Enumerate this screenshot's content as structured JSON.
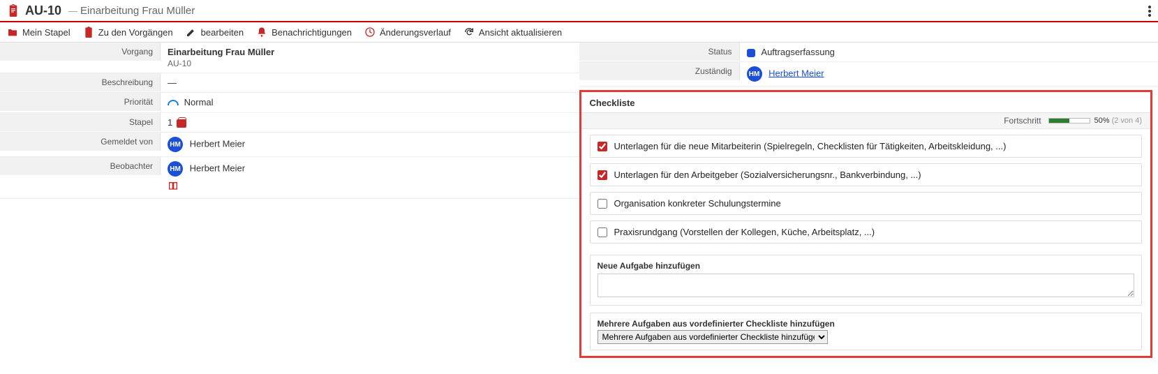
{
  "header": {
    "id": "AU-10",
    "separator": "—",
    "subtitle": "Einarbeitung Frau Müller"
  },
  "toolbar": {
    "mein_stapel": "Mein Stapel",
    "zu_vorgaengen": "Zu den Vorgängen",
    "bearbeiten": "bearbeiten",
    "benachrichtigungen": "Benachrichtigungen",
    "aenderungsverlauf": "Änderungsverlauf",
    "ansicht_aktualisieren": "Ansicht aktualisieren"
  },
  "fields_left": {
    "vorgang": {
      "label": "Vorgang",
      "value": "Einarbeitung Frau Müller",
      "sub": "AU-10"
    },
    "beschreibung": {
      "label": "Beschreibung",
      "value": "—"
    },
    "prioritaet": {
      "label": "Priorität",
      "value": "Normal"
    },
    "stapel": {
      "label": "Stapel",
      "value": "1"
    },
    "gemeldet_von": {
      "label": "Gemeldet von",
      "initials": "HM",
      "name": "Herbert Meier"
    },
    "beobachter": {
      "label": "Beobachter",
      "initials": "HM",
      "name": "Herbert Meier"
    }
  },
  "fields_right": {
    "status": {
      "label": "Status",
      "value": "Auftragserfassung"
    },
    "zustaendig": {
      "label": "Zuständig",
      "initials": "HM",
      "name": "Herbert Meier"
    }
  },
  "checklist": {
    "title": "Checkliste",
    "progress_label": "Fortschritt",
    "percent_value": 50,
    "percent_text": "50%",
    "count_text": "(2 von 4)",
    "items": [
      {
        "checked": true,
        "text": "Unterlagen für die neue Mitarbeiterin (Spielregeln, Checklisten für Tätigkeiten, Arbeitskleidung, ...)"
      },
      {
        "checked": true,
        "text": "Unterlagen für den Arbeitgeber (Sozialversicherungsnr., Bankverbindung, ...)"
      },
      {
        "checked": false,
        "text": "Organisation konkreter Schulungstermine"
      },
      {
        "checked": false,
        "text": "Praxisrundgang (Vorstellen der Kollegen, Küche, Arbeitsplatz, ...)"
      }
    ],
    "new_task_title": "Neue Aufgabe hinzufügen",
    "new_task_value": "",
    "multi_title": "Mehrere Aufgaben aus vordefinierter Checkliste hinzufügen",
    "multi_select_value": "Mehrere Aufgaben aus vordefinierter Checkliste hinzufügen"
  }
}
